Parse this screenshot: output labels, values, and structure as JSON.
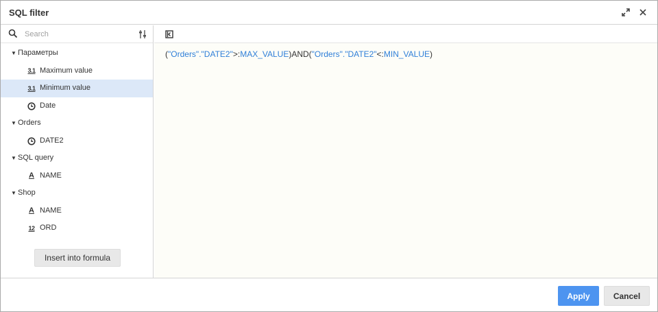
{
  "dialog": {
    "title": "SQL filter",
    "expand_icon": "expand-icon",
    "close_icon": "close-icon"
  },
  "search": {
    "placeholder": "Search",
    "value": "",
    "search_icon": "search-icon",
    "filter_icon": "filter-settings-icon"
  },
  "tree": {
    "groups": [
      {
        "label": "Параметры",
        "items": [
          {
            "label": "Maximum value",
            "icon": "3.1",
            "icon_name": "numeric-icon"
          },
          {
            "label": "Minimum value",
            "icon": "3.1",
            "icon_name": "numeric-icon",
            "selected": true
          },
          {
            "label": "Date",
            "icon": "clock",
            "icon_name": "date-icon"
          }
        ]
      },
      {
        "label": "Orders",
        "items": [
          {
            "label": "DATE2",
            "icon": "clock",
            "icon_name": "date-icon"
          }
        ]
      },
      {
        "label": "SQL query",
        "items": [
          {
            "label": "NAME",
            "icon": "A",
            "icon_name": "text-icon"
          }
        ]
      },
      {
        "label": "Shop",
        "items": [
          {
            "label": "NAME",
            "icon": "A",
            "icon_name": "text-icon"
          },
          {
            "label": "ORD",
            "icon": "12",
            "icon_name": "integer-icon"
          }
        ]
      }
    ]
  },
  "left_panel": {
    "insert_label": "Insert into formula"
  },
  "editor": {
    "collapse_icon": "collapse-panel-icon",
    "formula": {
      "p1": "(",
      "t1": "\"Orders\"",
      "d1": ".",
      "f1": "\"DATE2\"",
      "op1": ">:",
      "v1": "MAX_VALUE",
      "mid": ")AND(",
      "t2": "\"Orders\"",
      "d2": ".",
      "f2": "\"DATE2\"",
      "op2": "<:",
      "v2": "MIN_VALUE",
      "p2": ")"
    }
  },
  "footer": {
    "apply_label": "Apply",
    "cancel_label": "Cancel"
  },
  "colors": {
    "accent": "#4d94f0",
    "identifier": "#2f7fd8",
    "selected_row": "#dce8f8"
  }
}
